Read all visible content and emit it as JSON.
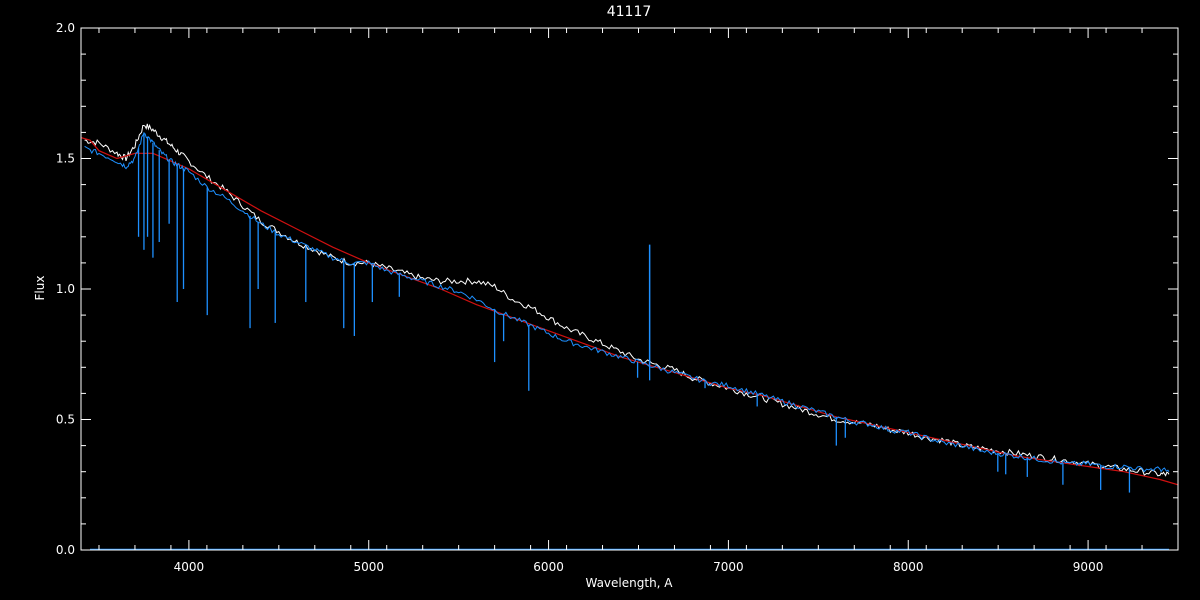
{
  "chart_data": {
    "type": "line",
    "title": "41117",
    "xlabel": "Wavelength, A",
    "ylabel": "Flux",
    "xlim": [
      3400,
      9500
    ],
    "ylim": [
      0.0,
      2.0
    ],
    "xticks": [
      4000,
      5000,
      6000,
      7000,
      8000,
      9000
    ],
    "xtick_labels": [
      "4000",
      "5000",
      "6000",
      "7000",
      "8000",
      "9000"
    ],
    "yticks": [
      0.0,
      0.5,
      1.0,
      1.5,
      2.0
    ],
    "ytick_labels": [
      "0.0",
      "0.5",
      "1.0",
      "1.5",
      "2.0"
    ],
    "grid": false,
    "colors": {
      "background": "#000000",
      "axes": "#ffffff",
      "white_series": "#ffffff",
      "blue_series": "#1e90ff",
      "red_series": "#d01010"
    },
    "series": [
      {
        "color": "#ffffff",
        "x": [
          3420,
          3500,
          3600,
          3650,
          3700,
          3750,
          3800,
          3850,
          3900,
          3950,
          4000,
          4100,
          4200,
          4300,
          4400,
          4500,
          4600,
          4700,
          4800,
          4900,
          5000,
          5100,
          5200,
          5300,
          5400,
          5500,
          5600,
          5700,
          5800,
          5900,
          6000,
          6100,
          6200,
          6300,
          6400,
          6500,
          6600,
          6700,
          6800,
          6900,
          7000,
          7100,
          7200,
          7300,
          7400,
          7500,
          7600,
          7700,
          7800,
          7900,
          8000,
          8100,
          8200,
          8300,
          8400,
          8500,
          8600,
          8700,
          8800,
          8900,
          9000,
          9100,
          9200,
          9300,
          9400,
          9450
        ],
        "y": [
          1.57,
          1.56,
          1.52,
          1.5,
          1.55,
          1.63,
          1.61,
          1.58,
          1.55,
          1.52,
          1.49,
          1.43,
          1.38,
          1.32,
          1.26,
          1.22,
          1.18,
          1.15,
          1.12,
          1.1,
          1.1,
          1.08,
          1.06,
          1.04,
          1.03,
          1.03,
          1.03,
          1.01,
          0.96,
          0.93,
          0.89,
          0.85,
          0.82,
          0.79,
          0.76,
          0.73,
          0.71,
          0.69,
          0.66,
          0.64,
          0.62,
          0.6,
          0.58,
          0.56,
          0.54,
          0.52,
          0.5,
          0.49,
          0.48,
          0.46,
          0.45,
          0.43,
          0.42,
          0.4,
          0.39,
          0.38,
          0.37,
          0.36,
          0.35,
          0.34,
          0.33,
          0.32,
          0.31,
          0.3,
          0.29,
          0.29
        ]
      },
      {
        "color": "#d01010",
        "x": [
          3400,
          3450,
          3500,
          3600,
          3700,
          3800,
          3900,
          4000,
          4200,
          4400,
          4600,
          4800,
          5000,
          5200,
          5400,
          5600,
          5800,
          6000,
          6200,
          6400,
          6600,
          6800,
          7000,
          7200,
          7400,
          7600,
          7800,
          8000,
          8200,
          8400,
          8600,
          8800,
          9000,
          9200,
          9400,
          9500
        ],
        "y": [
          1.58,
          1.57,
          1.53,
          1.5,
          1.52,
          1.52,
          1.49,
          1.46,
          1.38,
          1.3,
          1.23,
          1.16,
          1.1,
          1.05,
          1.0,
          0.94,
          0.89,
          0.84,
          0.79,
          0.74,
          0.7,
          0.66,
          0.62,
          0.59,
          0.55,
          0.51,
          0.48,
          0.45,
          0.42,
          0.39,
          0.36,
          0.34,
          0.32,
          0.3,
          0.27,
          0.25
        ]
      },
      {
        "color": "#1e90ff",
        "x": [
          3420,
          3500,
          3600,
          3650,
          3700,
          3750,
          3800,
          3850,
          3900,
          3950,
          4000,
          4100,
          4200,
          4300,
          4400,
          4500,
          4600,
          4700,
          4800,
          4900,
          5000,
          5100,
          5200,
          5300,
          5400,
          5500,
          5600,
          5700,
          5800,
          5900,
          6000,
          6100,
          6200,
          6300,
          6400,
          6500,
          6600,
          6700,
          6800,
          6900,
          7000,
          7100,
          7200,
          7300,
          7400,
          7500,
          7600,
          7700,
          7800,
          7900,
          8000,
          8100,
          8200,
          8300,
          8400,
          8500,
          8600,
          8700,
          8800,
          8900,
          9000,
          9100,
          9200,
          9300,
          9400,
          9450
        ],
        "y": [
          1.54,
          1.52,
          1.49,
          1.47,
          1.5,
          1.6,
          1.56,
          1.52,
          1.49,
          1.47,
          1.45,
          1.39,
          1.35,
          1.3,
          1.25,
          1.21,
          1.18,
          1.15,
          1.12,
          1.1,
          1.1,
          1.07,
          1.05,
          1.03,
          1.01,
          0.99,
          0.96,
          0.92,
          0.89,
          0.86,
          0.83,
          0.8,
          0.78,
          0.76,
          0.74,
          0.72,
          0.7,
          0.68,
          0.66,
          0.64,
          0.63,
          0.61,
          0.59,
          0.57,
          0.55,
          0.53,
          0.51,
          0.49,
          0.48,
          0.46,
          0.45,
          0.43,
          0.41,
          0.4,
          0.38,
          0.37,
          0.36,
          0.35,
          0.34,
          0.33,
          0.33,
          0.32,
          0.32,
          0.31,
          0.31,
          0.3
        ]
      }
    ],
    "blue_absorption_lines": [
      {
        "x": 3720,
        "y": 1.2
      },
      {
        "x": 3750,
        "y": 1.15
      },
      {
        "x": 3770,
        "y": 1.2
      },
      {
        "x": 3800,
        "y": 1.12
      },
      {
        "x": 3835,
        "y": 1.18
      },
      {
        "x": 3890,
        "y": 1.25
      },
      {
        "x": 3935,
        "y": 0.95
      },
      {
        "x": 3970,
        "y": 1.0
      },
      {
        "x": 4102,
        "y": 0.9
      },
      {
        "x": 4340,
        "y": 0.85
      },
      {
        "x": 4385,
        "y": 1.0
      },
      {
        "x": 4480,
        "y": 0.87
      },
      {
        "x": 4650,
        "y": 0.95
      },
      {
        "x": 4861,
        "y": 0.85
      },
      {
        "x": 4920,
        "y": 0.82
      },
      {
        "x": 5020,
        "y": 0.95
      },
      {
        "x": 5170,
        "y": 0.97
      },
      {
        "x": 5700,
        "y": 0.72
      },
      {
        "x": 5750,
        "y": 0.8
      },
      {
        "x": 5890,
        "y": 0.61
      },
      {
        "x": 6280,
        "y": 0.76
      },
      {
        "x": 6495,
        "y": 0.66
      },
      {
        "x": 6562,
        "y": 0.65
      },
      {
        "x": 6870,
        "y": 0.62
      },
      {
        "x": 7160,
        "y": 0.55
      },
      {
        "x": 7600,
        "y": 0.4
      },
      {
        "x": 7650,
        "y": 0.43
      },
      {
        "x": 8498,
        "y": 0.3
      },
      {
        "x": 8542,
        "y": 0.29
      },
      {
        "x": 8662,
        "y": 0.28
      },
      {
        "x": 8860,
        "y": 0.25
      },
      {
        "x": 9070,
        "y": 0.23
      },
      {
        "x": 9230,
        "y": 0.22
      }
    ],
    "blue_emission_lines": [
      {
        "x": 6562,
        "y": 1.17
      }
    ]
  }
}
